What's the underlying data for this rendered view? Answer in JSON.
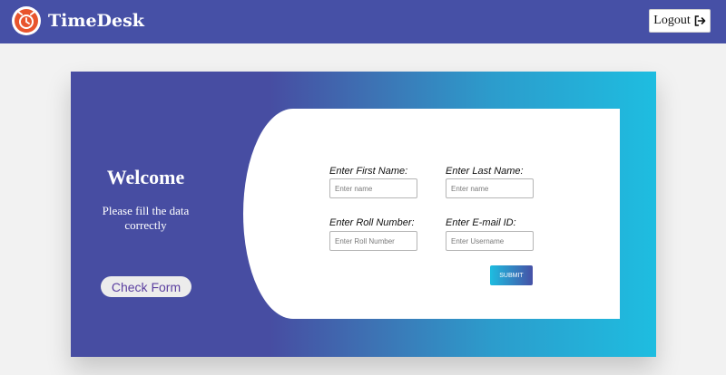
{
  "colors": {
    "navbar": "#4650a6",
    "card_gradient_start": "#474da2",
    "card_gradient_end": "#1ebde0",
    "check_form_text": "#5b3fa0",
    "logo_orange": "#e8542d"
  },
  "header": {
    "brand": "TimeDesk",
    "logo_icon": "alarm-clock-icon",
    "logout_label": "Logout",
    "logout_icon": "sign-out-icon"
  },
  "welcome": {
    "title": "Welcome",
    "subtitle": "Please fill the data correctly",
    "check_form_label": "Check Form"
  },
  "form": {
    "first_name": {
      "label": "Enter First Name:",
      "placeholder": "Enter name",
      "value": ""
    },
    "last_name": {
      "label": "Enter Last Name:",
      "placeholder": "Enter name",
      "value": ""
    },
    "roll_number": {
      "label": "Enter Roll Number:",
      "placeholder": "Enter Roll Number",
      "value": ""
    },
    "email": {
      "label": "Enter E-mail ID:",
      "placeholder": "Enter Username",
      "value": ""
    },
    "submit_label": "SUBMIT"
  }
}
